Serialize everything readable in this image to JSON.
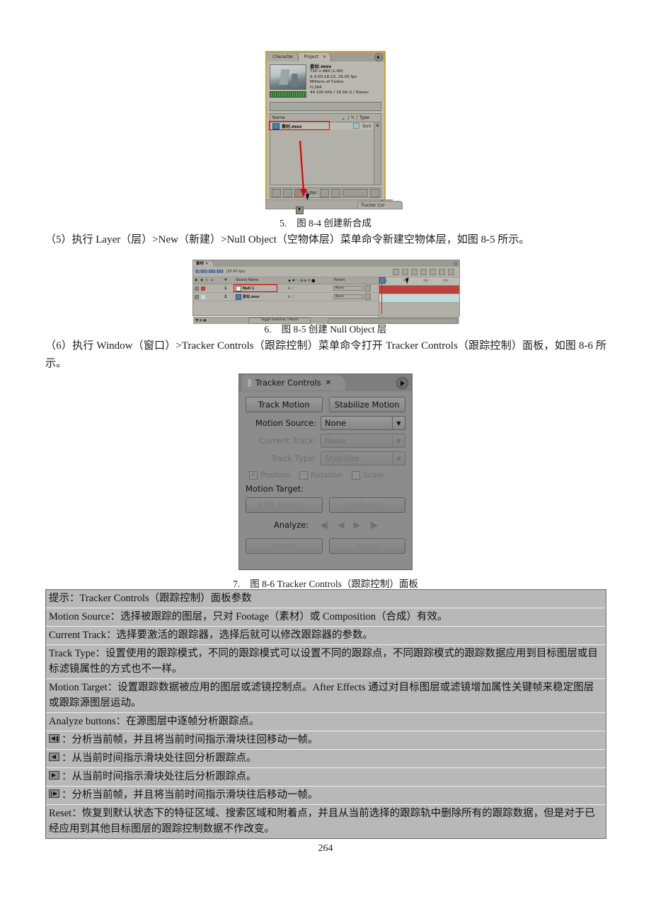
{
  "page": {
    "number": "264"
  },
  "figures": {
    "fig84": {
      "caption_num": "5.",
      "caption_text": "图 8-4 创建新合成",
      "panel": {
        "tab_character": "Character",
        "tab_project": "Project",
        "tab_close": "✕",
        "item_name": "素材.mov",
        "meta": [
          "720 x 480 (1.00)",
          "Δ 0:00:18:23, 25.00 fps",
          "Millions of Colors",
          "H.264",
          "44.100 kHz / 16 bit U / Stereo"
        ],
        "col_name": "Name",
        "col_type": "Type",
        "row_name": "素材.mov",
        "row_type": "Quic",
        "bit_depth": "8 bpc",
        "docked_panel": "Tracker Cor"
      }
    },
    "fig85": {
      "caption_num": "6.",
      "caption_text": "图 8-5 创建 Null Object 层",
      "panel": {
        "tab_label": "素材",
        "tab_close": "✕",
        "timecode": "0:00:00:00",
        "fps": "(25.00 fps)",
        "hdr_source_name": "Source Name",
        "hdr_hash": "#",
        "hdr_parent": "Parent",
        "rows": [
          {
            "index": "1",
            "name": "Null 1",
            "parent": "None"
          },
          {
            "index": "2",
            "name": "素材.mov",
            "parent": "None"
          }
        ],
        "toggle_switches": "Toggle Switches / Modes",
        "ruler_ticks": [
          "0s",
          "05s",
          "10s",
          "15s"
        ]
      }
    },
    "fig86": {
      "caption_num": "7.",
      "caption_text": "图 8-6   Tracker Controls（跟踪控制）面板",
      "panel": {
        "title": "Tracker Controls",
        "close": "✕",
        "track_motion": "Track Motion",
        "stabilize_motion": "Stabilize Motion",
        "motion_source_label": "Motion Source:",
        "motion_source_value": "None",
        "current_track_label": "Current Track:",
        "current_track_value": "None",
        "track_type_label": "Track Type:",
        "track_type_value": "Stabilize",
        "checkbox_position": "Position",
        "checkbox_rotation": "Rotation",
        "checkbox_scale": "Scale",
        "motion_target_label": "Motion Target:",
        "edit_target": "Edit Target...",
        "options": "Options...",
        "analyze_label": "Analyze:",
        "reset": "Reset",
        "apply": "Apply",
        "analyze_buttons": [
          "analyze-1-frame-backward-icon",
          "analyze-backward-icon",
          "analyze-forward-icon",
          "analyze-1-frame-forward-icon"
        ]
      }
    }
  },
  "body": {
    "para5": "（5）执行 Layer（层）>New（新建）>Null Object（空物体层）菜单命令新建空物体层，如图 8-5 所示。",
    "para6": "（6）执行 Window（窗口）>Tracker Controls（跟踪控制）菜单命令打开 Tracker Controls（跟踪控制）面板，如图 8-6 所示。"
  },
  "tip_table": {
    "rows": [
      {
        "icon": null,
        "text": "提示：Tracker Controls（跟踪控制）面板参数"
      },
      {
        "icon": null,
        "text": "Motion Source：选择被跟踪的图层，只对 Footage（素材）或 Composition（合成）有效。"
      },
      {
        "icon": null,
        "text": "Current Track：选择要激活的跟踪器，选择后就可以修改跟踪器的参数。"
      },
      {
        "icon": null,
        "text": "Track Type：设置使用的跟踪模式，不同的跟踪模式可以设置不同的跟踪点，不同跟踪模式的跟踪数据应用到目标图层或目标滤镜属性的方式也不一样。"
      },
      {
        "icon": null,
        "text": "Motion Target：设置跟踪数据被应用的图层或滤镜控制点。After Effects 通过对目标图层或滤镜增加属性关键帧来稳定图层或跟踪源图层运动。"
      },
      {
        "icon": null,
        "text": "Analyze buttons：在源图层中逐帧分析跟踪点。"
      },
      {
        "icon": "analyze-1-frame-backward-icon",
        "text": "：分析当前帧，并且将当前时间指示滑块往回移动一帧。"
      },
      {
        "icon": "analyze-backward-icon",
        "text": "：从当前时间指示滑块处往回分析跟踪点。"
      },
      {
        "icon": "analyze-forward-icon",
        "text": "：从当前时间指示滑块处往后分析跟踪点。"
      },
      {
        "icon": "analyze-1-frame-forward-icon",
        "text": "：分析当前帧，并且将当前时间指示滑块往后移动一帧。"
      },
      {
        "icon": null,
        "text": "Reset：恢复到默认状态下的特征区域、搜索区域和附着点，并且从当前选择的跟踪轨中删除所有的跟踪数据，但是对于已经应用到其他目标图层的跟踪控制数据不作改变。"
      }
    ]
  },
  "colors": {
    "accent_red": "#e00000",
    "panel_gray": "#8c8c8c",
    "table_gray": "#b8b8b8",
    "timeline_red": "#c0403c",
    "timeline_cyan": "#c3dadb",
    "tab_gold": "#d79f27"
  }
}
